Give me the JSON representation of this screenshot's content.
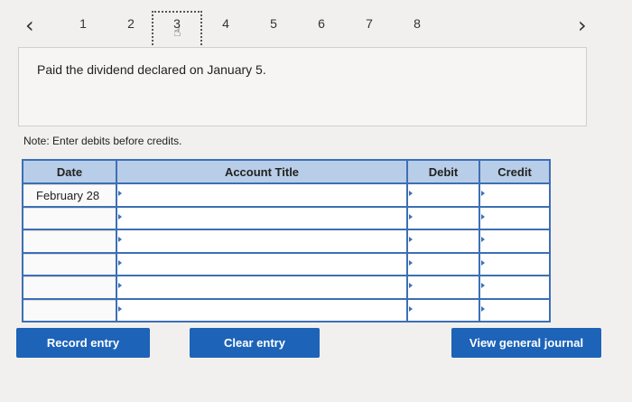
{
  "nav": {
    "pages": [
      "1",
      "2",
      "3",
      "4",
      "5",
      "6",
      "7",
      "8"
    ],
    "active_page": "3"
  },
  "question": {
    "text": "Paid the dividend declared on January 5."
  },
  "note": "Note: Enter debits before credits.",
  "table": {
    "headers": {
      "date": "Date",
      "account_title": "Account Title",
      "debit": "Debit",
      "credit": "Credit"
    },
    "rows": [
      {
        "date": "February 28",
        "account_title": "",
        "debit": "",
        "credit": ""
      },
      {
        "date": "",
        "account_title": "",
        "debit": "",
        "credit": ""
      },
      {
        "date": "",
        "account_title": "",
        "debit": "",
        "credit": ""
      },
      {
        "date": "",
        "account_title": "",
        "debit": "",
        "credit": ""
      },
      {
        "date": "",
        "account_title": "",
        "debit": "",
        "credit": ""
      },
      {
        "date": "",
        "account_title": "",
        "debit": "",
        "credit": ""
      }
    ]
  },
  "buttons": {
    "record": "Record entry",
    "clear": "Clear entry",
    "view": "View general journal"
  },
  "icons": {
    "prev": "chevron-left-icon",
    "next": "chevron-right-icon",
    "pointer": "hand-pointer-icon"
  }
}
